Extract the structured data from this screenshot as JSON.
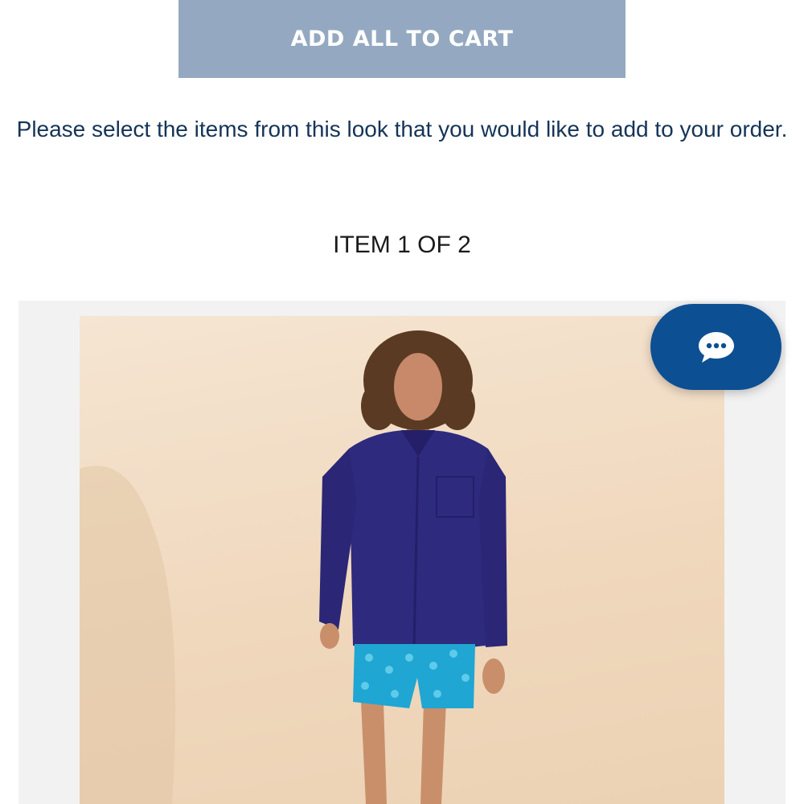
{
  "cart": {
    "add_all_label": "ADD ALL TO CART"
  },
  "instructions": {
    "text": "Please select the items from this look that you would like to add to your order."
  },
  "carousel": {
    "counter": "ITEM 1 OF 2"
  },
  "product_image": {
    "alt": "Model wearing navy linen shirt and turquoise printed swim shorts"
  },
  "chat": {
    "icon": "chat-bubble-icon",
    "color": "#0d4f93"
  },
  "colors": {
    "button_bg": "#94a9c1",
    "text_navy": "#153457",
    "shirt": "#2e2a7e",
    "shorts": "#1fa6d3"
  }
}
